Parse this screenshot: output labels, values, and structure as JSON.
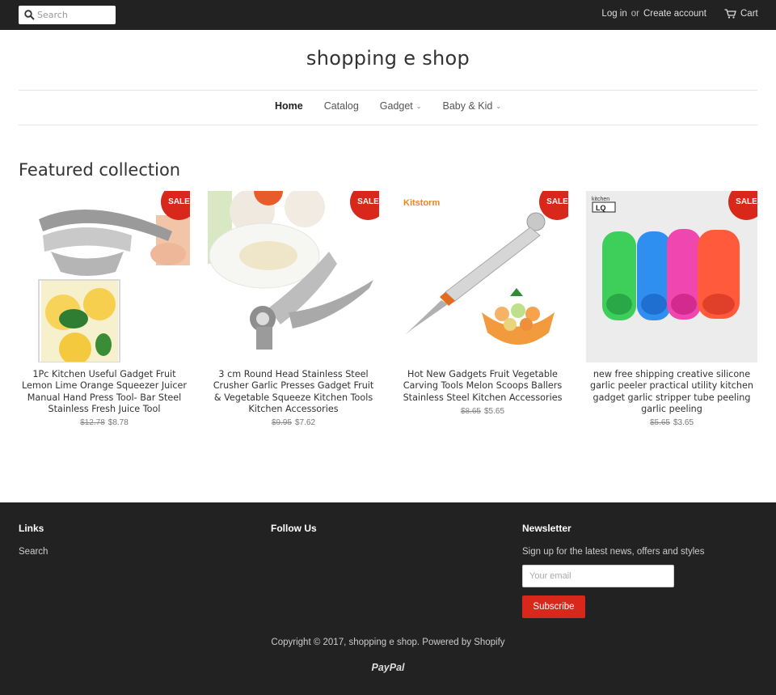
{
  "topbar": {
    "search_placeholder": "Search",
    "login": "Log in",
    "or": "or",
    "create_account": "Create account",
    "cart": "Cart"
  },
  "header": {
    "title": "shopping e shop"
  },
  "nav": {
    "items": [
      {
        "label": "Home",
        "active": true
      },
      {
        "label": "Catalog"
      },
      {
        "label": "Gadget",
        "dropdown": true
      },
      {
        "label": "Baby & Kid",
        "dropdown": true
      }
    ]
  },
  "featured": {
    "title": "Featured collection",
    "sale_label": "SALE",
    "products": [
      {
        "name": "1Pc Kitchen Useful Gadget Fruit Lemon Lime Orange Squeezer Juicer Manual Hand Press Tool- Bar Steel Stainless Fresh Juice Tool",
        "old_price": "$12.78",
        "price": "$8.78"
      },
      {
        "name": "3 cm Round Head Stainless Steel Crusher Garlic Presses Gadget Fruit & Vegetable Squeeze Kitchen Tools Kitchen Accessories",
        "old_price": "$9.95",
        "price": "$7.62"
      },
      {
        "name": "Hot New Gadgets Fruit Vegetable Carving Tools Melon Scoops Ballers Stainless Steel Kitchen Accessories",
        "old_price": "$8.65",
        "price": "$5.65",
        "brand": "Kitstorm"
      },
      {
        "name": "new free shipping creative silicone garlic peeler practical utility kitchen gadget garlic stripper tube peeling garlic peeling",
        "old_price": "$5.65",
        "price": "$3.65",
        "brand": "kitchen LQ"
      }
    ]
  },
  "footer": {
    "links_title": "Links",
    "links": [
      "Search"
    ],
    "follow_title": "Follow Us",
    "newsletter_title": "Newsletter",
    "newsletter_text": "Sign up for the latest news, offers and styles",
    "email_placeholder": "Your email",
    "subscribe": "Subscribe",
    "copyright": "Copyright © 2017, shopping e shop. Powered by Shopify",
    "payment": "PayPal"
  },
  "colors": {
    "accent": "#d7281b",
    "dark": "#222222"
  }
}
